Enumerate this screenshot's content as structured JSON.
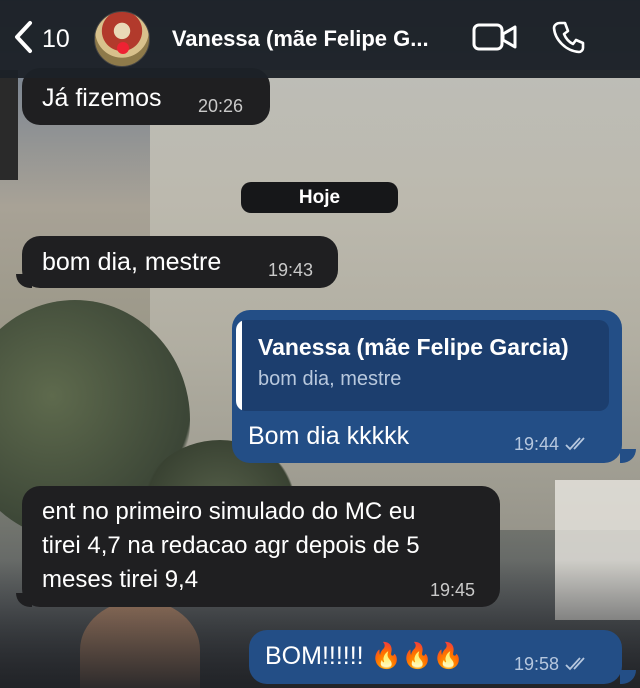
{
  "header": {
    "back_count": "10",
    "contact_name": "Vanessa (mãe Felipe G...",
    "icons": [
      "chevron-left-icon",
      "video-call-icon",
      "phone-icon"
    ]
  },
  "date_separator": "Hoje",
  "messages": [
    {
      "direction": "in",
      "text": "Já fizemos",
      "time": "20:26"
    },
    {
      "direction": "in",
      "text": "bom dia, mestre",
      "time": "19:43"
    },
    {
      "direction": "out",
      "reply_to_name": "Vanessa (mãe Felipe Garcia)",
      "reply_to_text": "bom dia, mestre",
      "text": "Bom dia kkkkk",
      "time": "19:44",
      "status": "read"
    },
    {
      "direction": "in",
      "lines": [
        "ent no primeiro simulado do MC eu",
        "tirei 4,7 na redacao agr depois de 5",
        "meses tirei 9,4"
      ],
      "time": "19:45"
    },
    {
      "direction": "out",
      "text": "BOM!!!!!! 🔥🔥🔥",
      "time": "19:58",
      "status": "read"
    }
  ],
  "colors": {
    "incoming_bubble": "#1f1f21",
    "outgoing_bubble": "#234e86",
    "header_bg": "#1c2128"
  }
}
